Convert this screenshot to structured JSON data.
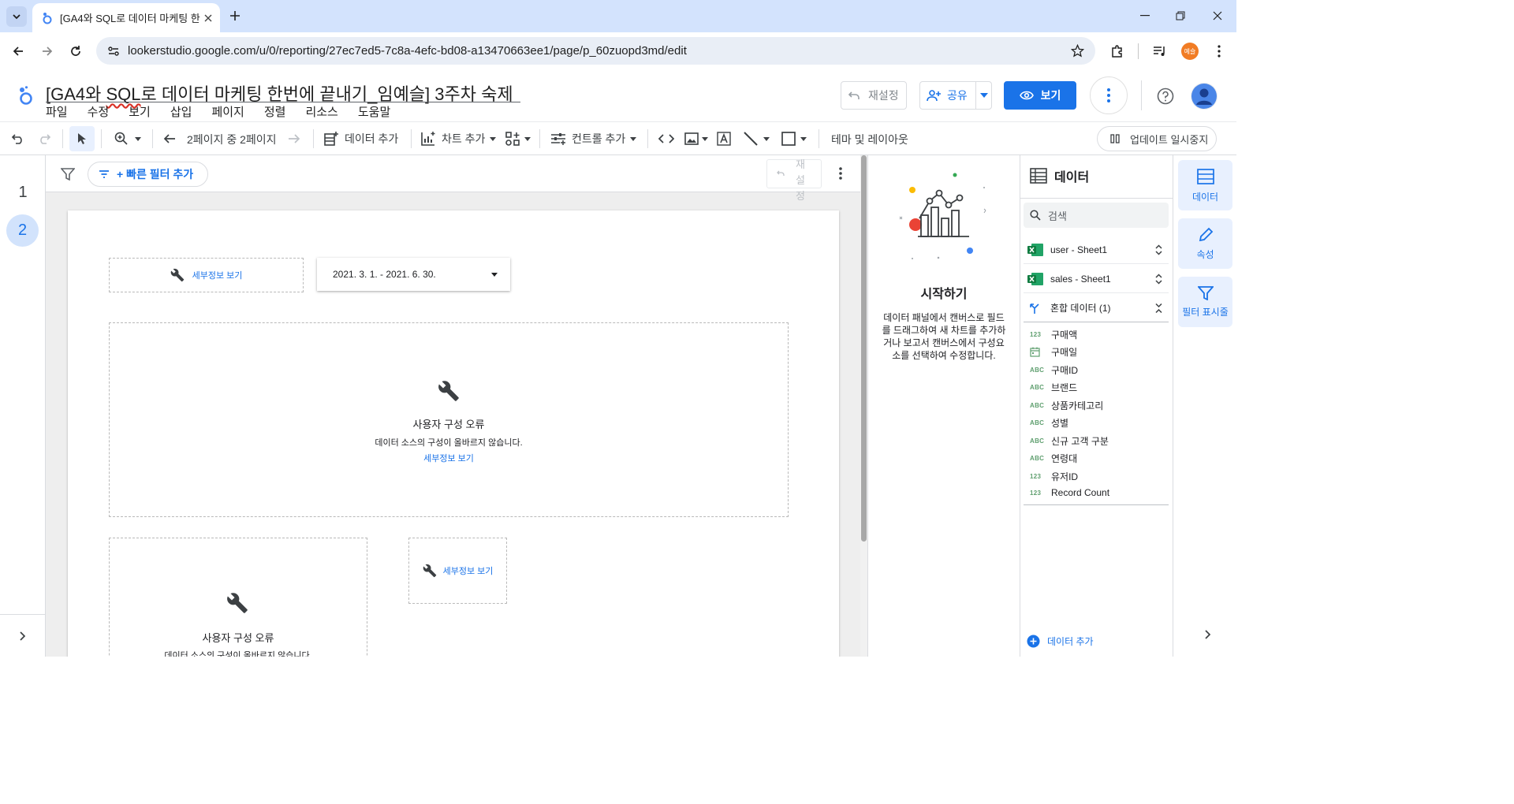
{
  "browser": {
    "tab_title": "[GA4와 SQL로 데이터 마케팅 한",
    "url": "lookerstudio.google.com/u/0/reporting/27ec7ed5-7c8a-4efc-bd08-a13470663ee1/page/p_60zuopd3md/edit",
    "profile_badge": "예슬"
  },
  "report": {
    "title_prefix": "[GA4와 ",
    "title_sql": "SQL",
    "title_rest": "로 데이터 마케팅 한번에 끝내기_임예슬] 3주차 숙제",
    "menus": [
      "파일",
      "수정",
      "보기",
      "삽입",
      "페이지",
      "정렬",
      "리소스",
      "도움말"
    ],
    "reset_label": "재설정",
    "share_label": "공유",
    "view_label": "보기"
  },
  "toolbar": {
    "page_indicator": "2페이지 중 2페이지",
    "add_data": "데이터 추가",
    "add_chart": "차트 추가",
    "add_control": "컨트롤 추가",
    "theme_layout": "테마 및 레이아웃",
    "pause_updates": "업데이트 일시중지"
  },
  "pages_rail": {
    "pages": [
      "1",
      "2"
    ],
    "active_page": "2"
  },
  "filter_bar": {
    "quick_filter": "+ 빠른 필터 추가",
    "reset_vertical": [
      "재",
      "설",
      "정"
    ]
  },
  "canvas": {
    "details_link": "세부정보 보기",
    "date_range": "2021. 3. 1. - 2021. 6. 30.",
    "error_title": "사용자 구성 오류",
    "error_desc": "데이터 소스의 구성이 올바르지 않습니다."
  },
  "helper": {
    "heading": "시작하기",
    "body": "데이터 패널에서 캔버스로 필드를 드래그하여 새 차트를 추가하거나 보고서 캔버스에서 구성요소를 선택하여 수정합니다."
  },
  "data_panel": {
    "title": "데이터",
    "search_placeholder": "검색",
    "sources": [
      {
        "name": "user - Sheet1"
      },
      {
        "name": "sales - Sheet1"
      },
      {
        "name": "혼합 데이터 (1)"
      }
    ],
    "fields": [
      {
        "type": "123",
        "name": "구매액"
      },
      {
        "type": "date",
        "name": "구매일"
      },
      {
        "type": "ABC",
        "name": "구매ID"
      },
      {
        "type": "ABC",
        "name": "브랜드"
      },
      {
        "type": "ABC",
        "name": "상품카테고리"
      },
      {
        "type": "ABC",
        "name": "성별"
      },
      {
        "type": "ABC",
        "name": "신규 고객 구분"
      },
      {
        "type": "ABC",
        "name": "연령대"
      },
      {
        "type": "123",
        "name": "유저ID"
      },
      {
        "type": "123",
        "name": "Record Count"
      }
    ],
    "add_data": "데이터 추가"
  },
  "side_rail": {
    "data": "데이터",
    "properties": "속성",
    "filter": "필터 표시줄"
  }
}
